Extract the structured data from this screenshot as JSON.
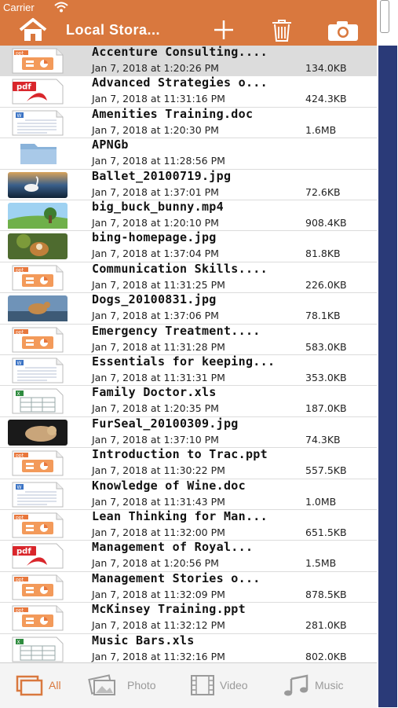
{
  "status_bar": {
    "carrier": "Carrier"
  },
  "nav": {
    "title": "Local Stora...",
    "home_icon": "home-icon",
    "add_icon": "plus-icon",
    "trash_icon": "trash-icon",
    "camera_icon": "camera-icon"
  },
  "colors": {
    "accent": "#d9783e",
    "side_bar": "#2a3a78",
    "tab_inactive": "#9a9a9a"
  },
  "files": [
    {
      "name": "Accenture Consulting....",
      "date": "Jan 7, 2018 at 1:20:26 PM",
      "size": "134.0KB",
      "type": "ppt",
      "selected": true
    },
    {
      "name": "Advanced Strategies o...",
      "date": "Jan 7, 2018 at 11:31:16 PM",
      "size": "424.3KB",
      "type": "pdf"
    },
    {
      "name": "Amenities Training.doc",
      "date": "Jan 7, 2018 at 1:20:30 PM",
      "size": "1.6MB",
      "type": "doc"
    },
    {
      "name": "APNGb",
      "date": "Jan 7, 2018 at 11:28:56 PM",
      "size": "",
      "type": "folder"
    },
    {
      "name": "Ballet_20100719.jpg",
      "date": "Jan 7, 2018 at 1:37:01 PM",
      "size": "72.6KB",
      "type": "img-ballet"
    },
    {
      "name": "big_buck_bunny.mp4",
      "date": "Jan 7, 2018 at 1:20:10 PM",
      "size": "908.4KB",
      "type": "img-bunny"
    },
    {
      "name": "bing-homepage.jpg",
      "date": "Jan 7, 2018 at 1:37:04 PM",
      "size": "81.8KB",
      "type": "img-bing"
    },
    {
      "name": "Communication Skills....",
      "date": "Jan 7, 2018 at 11:31:25 PM",
      "size": "226.0KB",
      "type": "ppt"
    },
    {
      "name": "Dogs_20100831.jpg",
      "date": "Jan 7, 2018 at 1:37:06 PM",
      "size": "78.1KB",
      "type": "img-dogs"
    },
    {
      "name": "Emergency Treatment....",
      "date": "Jan 7, 2018 at 11:31:28 PM",
      "size": "583.0KB",
      "type": "ppt"
    },
    {
      "name": "Essentials for keeping...",
      "date": "Jan 7, 2018 at 11:31:31 PM",
      "size": "353.0KB",
      "type": "doc"
    },
    {
      "name": "Family Doctor.xls",
      "date": "Jan 7, 2018 at 1:20:35 PM",
      "size": "187.0KB",
      "type": "xls"
    },
    {
      "name": "FurSeal_20100309.jpg",
      "date": "Jan 7, 2018 at 1:37:10 PM",
      "size": "74.3KB",
      "type": "img-seal"
    },
    {
      "name": "Introduction to Trac.ppt",
      "date": "Jan 7, 2018 at 11:30:22 PM",
      "size": "557.5KB",
      "type": "ppt"
    },
    {
      "name": "Knowledge of Wine.doc",
      "date": "Jan 7, 2018 at 11:31:43 PM",
      "size": "1.0MB",
      "type": "doc"
    },
    {
      "name": "Lean Thinking for Man...",
      "date": "Jan 7, 2018 at 11:32:00 PM",
      "size": "651.5KB",
      "type": "ppt"
    },
    {
      "name": "Management of Royal...",
      "date": "Jan 7, 2018 at 1:20:56 PM",
      "size": "1.5MB",
      "type": "pdf"
    },
    {
      "name": "Management Stories o...",
      "date": "Jan 7, 2018 at 11:32:09 PM",
      "size": "878.5KB",
      "type": "ppt"
    },
    {
      "name": "McKinsey Training.ppt",
      "date": "Jan 7, 2018 at 11:32:12 PM",
      "size": "281.0KB",
      "type": "ppt"
    },
    {
      "name": "Music Bars.xls",
      "date": "Jan 7, 2018 at 11:32:16 PM",
      "size": "802.0KB",
      "type": "xls"
    }
  ],
  "tabs": [
    {
      "label": "All",
      "icon": "all-files-icon",
      "active": true
    },
    {
      "label": "Photo",
      "icon": "photo-icon",
      "active": false
    },
    {
      "label": "Video",
      "icon": "film-icon",
      "active": false
    },
    {
      "label": "Music",
      "icon": "music-note-icon",
      "active": false
    }
  ]
}
